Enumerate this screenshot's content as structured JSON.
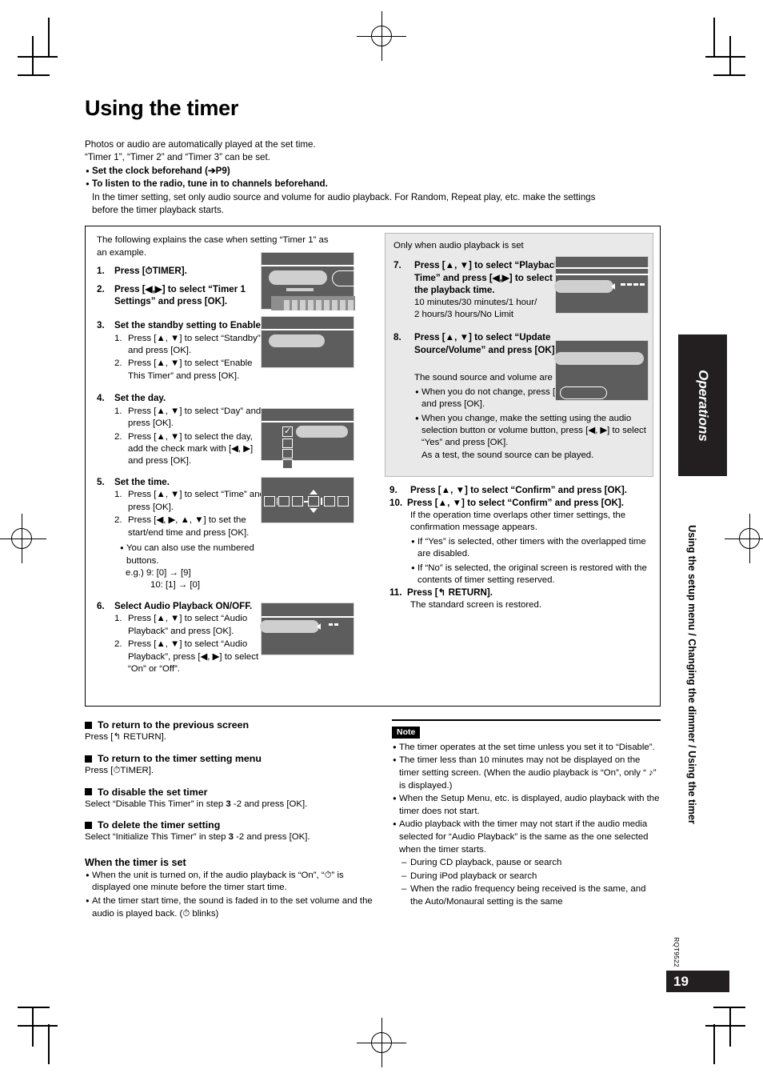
{
  "page": {
    "title": "Using the timer",
    "number": "19",
    "doc_code": "RQT9522",
    "side_tab_black": "Operations",
    "side_tab_text": "Using the setup menu / Changing the dimmer / Using the timer"
  },
  "intro": {
    "line1": "Photos or audio are automatically played at the set time.",
    "line2": "“Timer 1”, “Timer 2” and “Timer 3” can be set.",
    "bullet1": "Set the clock beforehand (➔P9)",
    "bullet2": "To listen to the radio, tune in to channels beforehand.",
    "bullet2_body_line1": "In the timer setting, set only audio source and volume for audio playback. For Random, Repeat play, etc. make the settings",
    "bullet2_body_line2": "before the timer playback starts."
  },
  "procedure": {
    "lead_line1": "The following explains the case when setting “Timer 1” as",
    "lead_line2": "an example.",
    "steps": [
      {
        "num": "1.",
        "title": "Press [⏱TIMER]."
      },
      {
        "num": "2.",
        "title": "Press [◀,▶] to select “Timer 1 Settings” and press [OK]."
      },
      {
        "num": "3.",
        "title": "Set the standby setting to Enable.",
        "subs": [
          {
            "n": "1.",
            "t": "Press [▲, ▼] to select “Standby” and press [OK]."
          },
          {
            "n": "2.",
            "t": "Press [▲, ▼] to select “Enable This Timer” and press [OK]."
          }
        ]
      },
      {
        "num": "4.",
        "title": "Set the day.",
        "subs": [
          {
            "n": "1.",
            "t": "Press [▲, ▼] to select “Day” and press [OK]."
          },
          {
            "n": "2.",
            "t": "Press [▲, ▼] to select the day, add the check mark with [◀, ▶] and press [OK]."
          }
        ]
      },
      {
        "num": "5.",
        "title": "Set the time.",
        "subs": [
          {
            "n": "1.",
            "t": "Press [▲, ▼] to select “Time” and press [OK]."
          },
          {
            "n": "2.",
            "t": "Press [◀, ▶, ▲, ▼] to set the start/end time and press [OK]."
          }
        ],
        "note_bullet": "You can also use the numbered buttons.",
        "note_eg1": "e.g.) 9: [0] → [9]",
        "note_eg2": "10: [1] → [0]"
      },
      {
        "num": "6.",
        "title": "Select Audio Playback ON/OFF.",
        "subs": [
          {
            "n": "1.",
            "t": "Press [▲, ▼] to select “Audio Playback” and press [OK]."
          },
          {
            "n": "2.",
            "t": "Press [▲, ▼] to select “Audio Playback”, press [◀, ▶] to select “On” or “Off”."
          }
        ]
      }
    ]
  },
  "audio_section": {
    "heading": "Only when audio playback is set",
    "step7": {
      "num": "7.",
      "title": "Press [▲, ▼] to select “Playback Time” and press [◀,▶] to select the playback time.",
      "options_line1": "10 minutes/30 minutes/1 hour/",
      "options_line2": "2 hours/3 hours/No Limit"
    },
    "step8": {
      "num": "8.",
      "title": "Press [▲, ▼] to select “Update Source/Volume” and press [OK].",
      "desc": "The sound source and volume are displayed.",
      "bullets": [
        "When you do not change, press [◀, ▶] to select “No” and press [OK].",
        "When you change, make the setting using the audio selection button or volume button, press [◀, ▶] to select “Yes” and press [OK]."
      ],
      "tail": "As a test, the sound source can be played."
    }
  },
  "final_steps": {
    "step9": {
      "num": "9.",
      "title": "Press [▲, ▼] to select “Confirm” and press [OK]."
    },
    "step10": {
      "num": "10.",
      "title": "Press [▲, ▼] to select “Confirm” and press [OK].",
      "desc": "If the operation time overlaps other timer settings, the confirmation message appears.",
      "bullets": [
        "If “Yes” is selected, other timers with the overlapped time are disabled.",
        "If “No” is selected, the original screen is restored with the contents of timer setting reserved."
      ]
    },
    "step11": {
      "num": "11.",
      "title": "Press [↰ RETURN].",
      "desc": "The standard screen is restored."
    }
  },
  "tips": [
    {
      "heading": "To return to the previous screen",
      "body": "Press [↰ RETURN]."
    },
    {
      "heading": "To return to the timer setting menu",
      "body": "Press [⏱TIMER]."
    },
    {
      "heading": "To disable the set timer",
      "body_pre": "Select “Disable This Timer” in step ",
      "body_bold": "3",
      "body_post": " -2 and press [OK]."
    },
    {
      "heading": "To delete the timer setting",
      "body_pre": "Select “Initialize This Timer” in step ",
      "body_bold": "3",
      "body_post": " -2 and press [OK]."
    }
  ],
  "when_set": {
    "heading": "When the timer is set",
    "bullets": [
      "When the unit is turned on, if the audio playback is “On”, “⏱” is displayed one minute before the timer start time.",
      "At the timer start time, the sound is faded in to the set volume and the audio is played back. (⏱ blinks)"
    ]
  },
  "note": {
    "label": "Note",
    "bullets": [
      "The timer operates at the set time unless you set it to “Disable”.",
      "The timer less than 10 minutes may not be displayed on the timer setting screen. (When the audio playback is “On”, only “ ♪” is displayed.)",
      "When the Setup Menu, etc. is displayed, audio playback with the timer does not start.",
      "Audio playback with the timer may not start if the audio media selected for “Audio Playback” is the same as the one selected when the timer starts."
    ],
    "sub_dashes": [
      "During CD playback, pause or search",
      "During iPod playback or search",
      "When the radio frequency being received is the same, and the Auto/Monaural setting is the same"
    ]
  },
  "colors": {
    "screen_bg": "#5d5d5d",
    "screen_highlight": "#cfcfcf",
    "shaded_panel": "#e9e9e9",
    "tab_black": "#231f20"
  }
}
